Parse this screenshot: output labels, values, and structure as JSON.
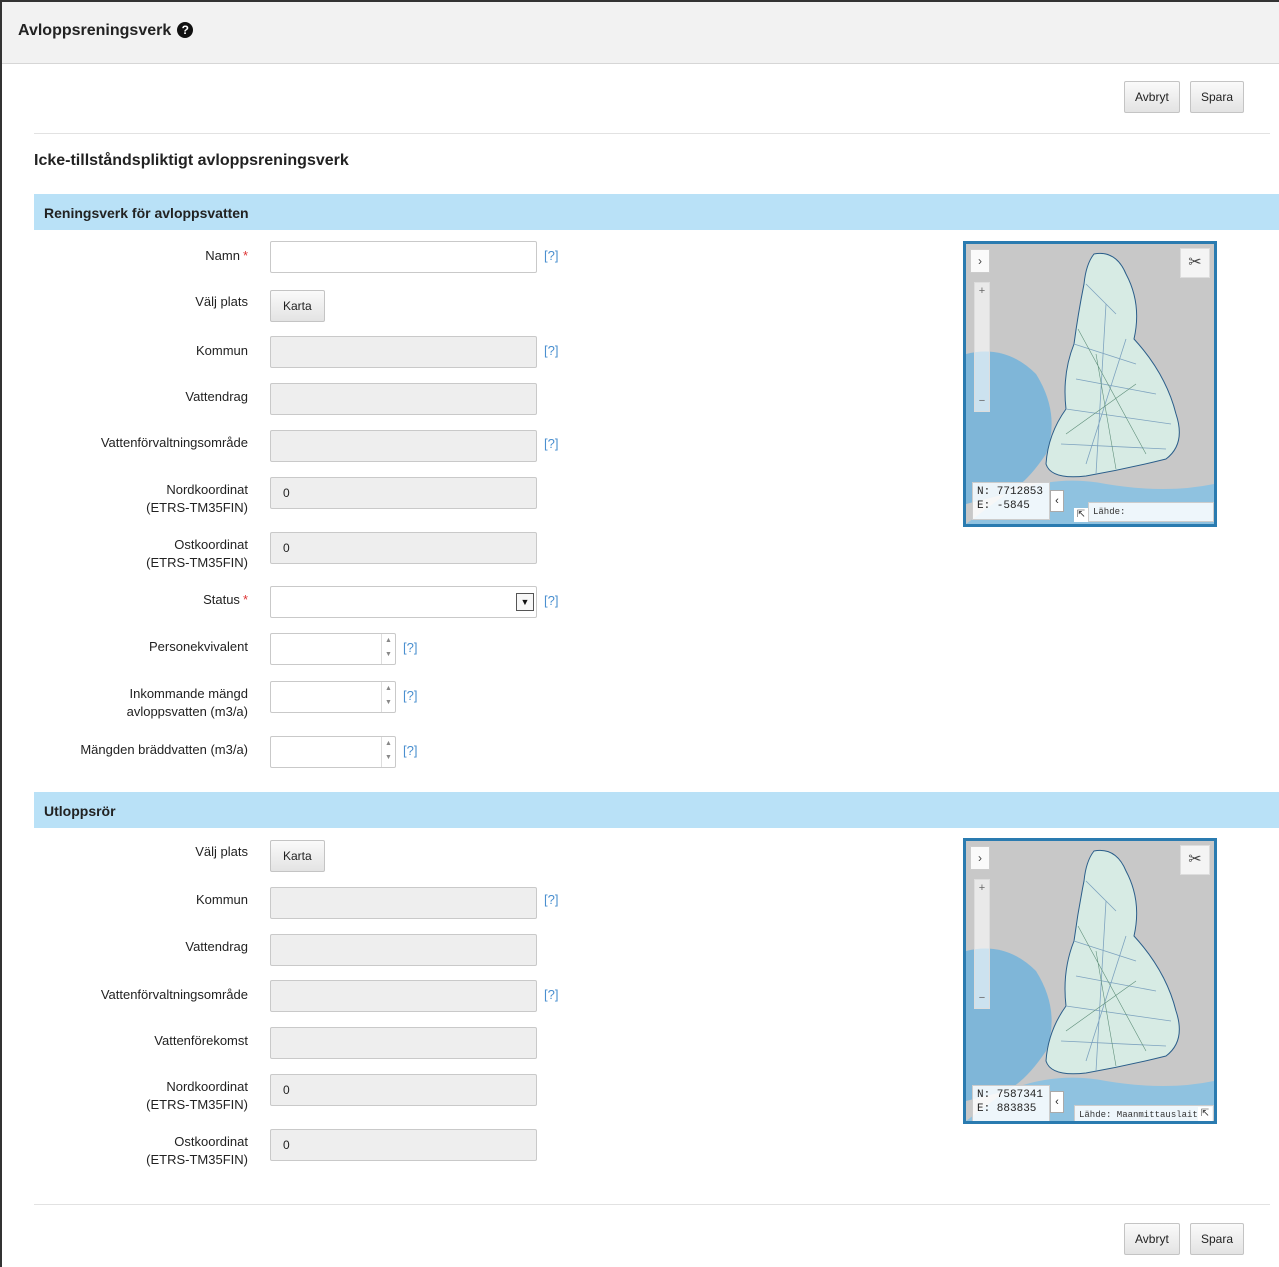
{
  "header": {
    "title": "Avloppsreningsverk",
    "help_icon": "question-circle-icon"
  },
  "actions": {
    "cancel": "Avbryt",
    "save": "Spara"
  },
  "page": {
    "title": "Icke-tillståndspliktigt avloppsreningsverk"
  },
  "help_marker": "[?]",
  "required_marker": "*",
  "section1": {
    "title": "Reningsverk för avloppsvatten",
    "labels": {
      "name": "Namn",
      "choose_location": "Välj plats",
      "municipality": "Kommun",
      "watercourse": "Vattendrag",
      "water_district": "Vattenförvaltningsområde",
      "north_1": "Nordkoordinat",
      "north_2": "(ETRS-TM35FIN)",
      "east_1": "Ostkoordinat",
      "east_2": "(ETRS-TM35FIN)",
      "status": "Status",
      "pe": "Personekvivalent",
      "incoming_1": "Inkommande mängd",
      "incoming_2": "avloppsvatten (m3/a)",
      "overflow": "Mängden bräddvatten (m3/a)"
    },
    "values": {
      "name": "",
      "municipality": "",
      "watercourse": "",
      "water_district": "",
      "north": "0",
      "east": "0",
      "status": "",
      "pe": "",
      "incoming": "",
      "overflow": ""
    },
    "map_button": "Karta",
    "map": {
      "n": "N: 7712853",
      "e": "E: -5845",
      "source": "Lähde: Maanmittauslaitos"
    }
  },
  "section2": {
    "title": "Utloppsrör",
    "labels": {
      "choose_location": "Välj plats",
      "municipality": "Kommun",
      "watercourse": "Vattendrag",
      "water_district": "Vattenförvaltningsområde",
      "water_body": "Vattenförekomst",
      "north_1": "Nordkoordinat",
      "north_2": "(ETRS-TM35FIN)",
      "east_1": "Ostkoordinat",
      "east_2": "(ETRS-TM35FIN)"
    },
    "values": {
      "municipality": "",
      "watercourse": "",
      "water_district": "",
      "water_body": "",
      "north": "0",
      "east": "0"
    },
    "map_button": "Karta",
    "map": {
      "n": "N: 7587341",
      "e": "E: 883835",
      "source": "Lähde: Maanmittauslaitos"
    }
  },
  "colors": {
    "section_bar": "#b9e1f7",
    "map_border": "#2a7bb0",
    "required": "#d33333",
    "help_link": "#4a8fcf"
  }
}
